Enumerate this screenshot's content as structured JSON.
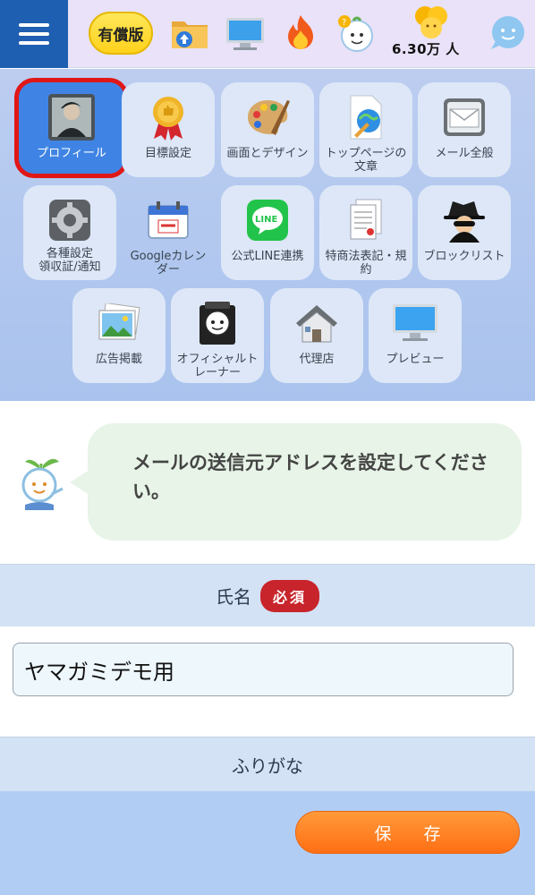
{
  "header": {
    "paid_label": "有償版",
    "users_count": "6.30万 人"
  },
  "menu_tiles": [
    {
      "label": "プロフィール",
      "icon": "profile-photo-icon"
    },
    {
      "label": "目標設定",
      "icon": "medal-icon"
    },
    {
      "label": "画面とデザイン",
      "icon": "palette-icon"
    },
    {
      "label": "トップページの文章",
      "icon": "document-globe-icon"
    },
    {
      "label": "メール全般",
      "icon": "mail-icon"
    },
    {
      "label": "各種設定\n領収証/通知",
      "icon": "gear-icon"
    },
    {
      "label": "Googleカレンダー",
      "icon": "calendar-icon"
    },
    {
      "label": "公式LINE連携",
      "icon": "line-icon"
    },
    {
      "label": "特商法表記・規約",
      "icon": "pages-icon"
    },
    {
      "label": "ブロックリスト",
      "icon": "spy-icon"
    },
    {
      "label": "広告掲載",
      "icon": "photo-icon"
    },
    {
      "label": "オフィシャルトレーナー",
      "icon": "trainer-icon"
    },
    {
      "label": "代理店",
      "icon": "house-icon"
    },
    {
      "label": "プレビュー",
      "icon": "monitor-icon"
    }
  ],
  "speech": {
    "text": "メールの送信元アドレスを設定してください。"
  },
  "form": {
    "name_label": "氏名",
    "required_badge": "必須",
    "name_value": "ヤマガミデモ用",
    "furigana_label": "ふりがな"
  },
  "footer": {
    "save_label": "保存"
  }
}
